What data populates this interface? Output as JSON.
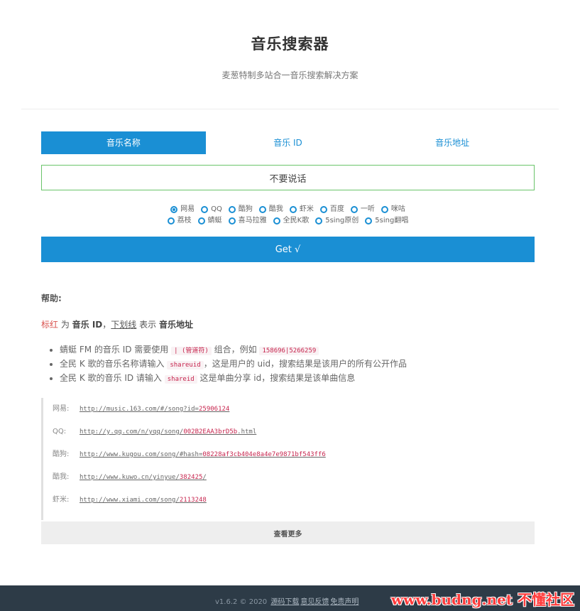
{
  "header": {
    "title": "音乐搜索器",
    "subtitle": "麦葱特制多站合一音乐搜索解决方案"
  },
  "tabs": [
    {
      "label": "音乐名称"
    },
    {
      "label": "音乐 ID"
    },
    {
      "label": "音乐地址"
    }
  ],
  "search": {
    "value": "不要说话"
  },
  "sources_row1": [
    "网易",
    "QQ",
    "酷狗",
    "酷我",
    "虾米",
    "百度",
    "一听",
    "咪咕"
  ],
  "sources_row2": [
    "荔枝",
    "蜻蜓",
    "喜马拉雅",
    "全民K歌",
    "5sing原创",
    "5sing翻唱"
  ],
  "selected_source": "网易",
  "get_button": "Get √",
  "help": {
    "title": "帮助:",
    "legend": {
      "red": "标红",
      "t1": " 为 ",
      "b1": "音乐 ID",
      "t2": "，",
      "under": "下划线",
      "t3": " 表示 ",
      "b2": "音乐地址"
    },
    "items": [
      {
        "pre": "蜻蜓 FM 的音乐 ID 需要使用 ",
        "code": "| (管道符)",
        "post": " 组合，例如 ",
        "code2": "158696|5266259",
        "post2": ""
      },
      {
        "pre": "全民 K 歌的音乐名称请输入 ",
        "code": "shareuid",
        "post": "，这是用户的 uid，搜索结果是该用户的所有公开作品",
        "code2": "",
        "post2": ""
      },
      {
        "pre": "全民 K 歌的音乐 ID 请输入 ",
        "code": "shareid",
        "post": " 这是单曲分享 id，搜索结果是该单曲信息",
        "code2": "",
        "post2": ""
      }
    ]
  },
  "examples": [
    {
      "label": "网易:",
      "url": "http://music.163.com/#/song?id=",
      "id": "25906124"
    },
    {
      "label": "QQ:",
      "url": "http://y.qq.com/n/yqq/song/",
      "id": "002B2EAA3brD5b",
      "suffix": ".html"
    },
    {
      "label": "酷狗:",
      "url": "http://www.kugou.com/song/#hash=",
      "id": "08228af3cb404e8a4e7e9871bf543ff6"
    },
    {
      "label": "酷我:",
      "url": "http://www.kuwo.cn/yinyue/",
      "id": "382425",
      "suffix": "/"
    },
    {
      "label": "虾米:",
      "url": "http://www.xiami.com/song/",
      "id": "2113248"
    }
  ],
  "more_button": "查看更多",
  "footer": {
    "version": "v1.6.2 © 2020 ",
    "links": [
      "源码下载",
      "意见反馈",
      "免责声明"
    ]
  },
  "watermark": "www.budng.net 不懂社区",
  "colors": {
    "accent": "#1a8fd4",
    "input_border": "#6ac46a",
    "code": "#c7254e",
    "footer_bg": "#2d3b47"
  }
}
